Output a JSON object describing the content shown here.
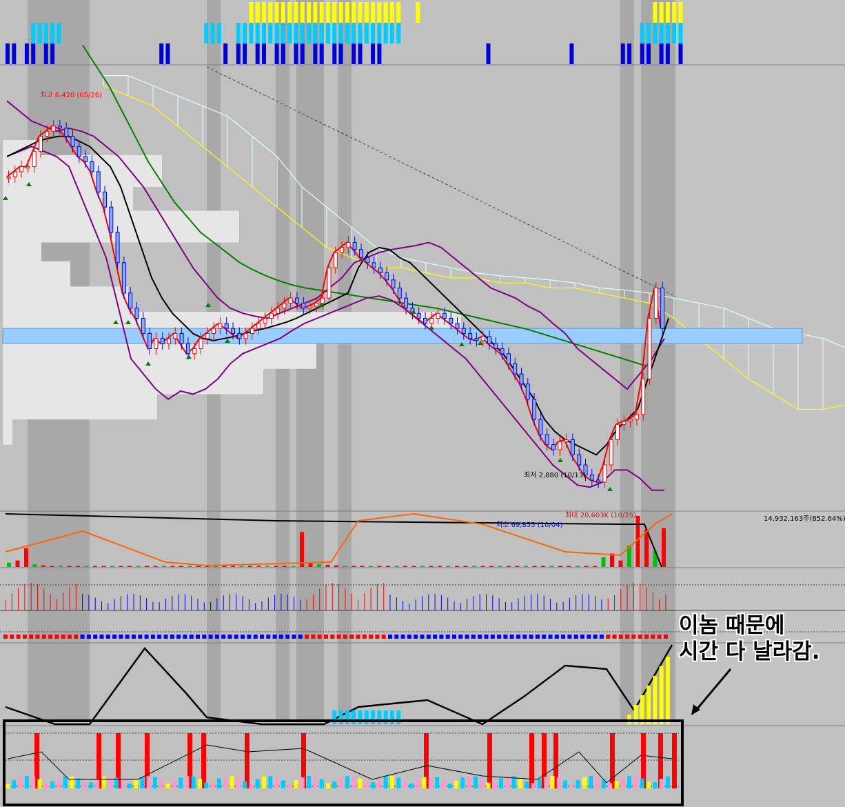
{
  "chart_data": {
    "type": "candlestick",
    "annotations": {
      "high": "최고 6,420 (05/26)",
      "low": "최저 2,880 (10/13)",
      "volume_max": "최대 20,603K (10/25)",
      "volume_min": "최소 69,855 (10/04)",
      "volume_last": "14,932,163주(852.64%)"
    },
    "close_series": [
      5900,
      5950,
      6000,
      6000,
      6150,
      6300,
      6350,
      6400,
      6380,
      6300,
      6200,
      6100,
      6050,
      5950,
      5750,
      5600,
      5350,
      5050,
      4750,
      4600,
      4500,
      4350,
      4200,
      4300,
      4250,
      4300,
      4350,
      4250,
      4150,
      4200,
      4300,
      4350,
      4400,
      4450,
      4400,
      4350,
      4300,
      4350,
      4400,
      4450,
      4500,
      4550,
      4600,
      4650,
      4700,
      4650,
      4600,
      4620,
      4650,
      4700,
      5000,
      5150,
      5200,
      5250,
      5180,
      5100,
      5050,
      5000,
      4950,
      4880,
      4800,
      4700,
      4600,
      4550,
      4500,
      4450,
      4500,
      4550,
      4500,
      4450,
      4400,
      4350,
      4300,
      4280,
      4320,
      4250,
      4200,
      4150,
      4050,
      3950,
      3850,
      3700,
      3500,
      3350,
      3250,
      3200,
      3280,
      3300,
      3150,
      3050,
      2950,
      2900,
      2880,
      3050,
      3300,
      3450,
      3480,
      3500,
      3550,
      3900,
      4500,
      4800,
      4400
    ],
    "ma_short": [
      6100,
      6150,
      6200,
      6250,
      6280,
      6300,
      6300,
      6250,
      6200,
      6100,
      6000,
      5800,
      5500,
      5200,
      4900,
      4700,
      4550,
      4450,
      4350,
      4300,
      4280,
      4300,
      4320,
      4350,
      4380,
      4400,
      4430,
      4460,
      4500,
      4550,
      4600,
      4650,
      4700,
      4750,
      5000,
      5150,
      5200,
      5180,
      5100,
      5050,
      4950,
      4850,
      4750,
      4650,
      4550,
      4450,
      4350,
      4250,
      4150,
      4000,
      3850,
      3700,
      3500,
      3380,
      3300,
      3250,
      3200,
      3150,
      3250,
      3400,
      3500,
      3600,
      3900,
      4200,
      4500
    ],
    "ma_long": [
      7200,
      7000,
      6800,
      6550,
      6300,
      6050,
      5850,
      5650,
      5500,
      5350,
      5250,
      5150,
      5050,
      4980,
      4920,
      4870,
      4830,
      4800,
      4780,
      4760,
      4740,
      4720,
      4700,
      4680,
      4660,
      4640,
      4620,
      4600,
      4570,
      4540,
      4510,
      4480,
      4450,
      4420,
      4390,
      4350,
      4310,
      4270,
      4230,
      4190,
      4150,
      4110,
      4070,
      4030
    ],
    "ichimoku_cloud": [
      {
        "a": 6800,
        "b": 6900
      },
      {
        "a": 6700,
        "b": 6900
      },
      {
        "a": 6600,
        "b": 6800
      },
      {
        "a": 6400,
        "b": 6700
      },
      {
        "a": 6200,
        "b": 6600
      },
      {
        "a": 6000,
        "b": 6500
      },
      {
        "a": 5800,
        "b": 6300
      },
      {
        "a": 5600,
        "b": 6100
      },
      {
        "a": 5400,
        "b": 5800
      },
      {
        "a": 5200,
        "b": 5600
      },
      {
        "a": 5100,
        "b": 5400
      },
      {
        "a": 5000,
        "b": 5200
      },
      {
        "a": 5000,
        "b": 5100
      },
      {
        "a": 4950,
        "b": 5050
      },
      {
        "a": 4900,
        "b": 5000
      },
      {
        "a": 4900,
        "b": 4950
      },
      {
        "a": 4850,
        "b": 4920
      },
      {
        "a": 4850,
        "b": 4900
      },
      {
        "a": 4800,
        "b": 4880
      },
      {
        "a": 4800,
        "b": 4850
      },
      {
        "a": 4750,
        "b": 4800
      },
      {
        "a": 4700,
        "b": 4780
      },
      {
        "a": 4650,
        "b": 4750
      },
      {
        "a": 4500,
        "b": 4700
      },
      {
        "a": 4300,
        "b": 4650
      },
      {
        "a": 4100,
        "b": 4600
      },
      {
        "a": 3900,
        "b": 4500
      },
      {
        "a": 3750,
        "b": 4400
      },
      {
        "a": 3600,
        "b": 4350
      },
      {
        "a": 3600,
        "b": 4300
      },
      {
        "a": 3650,
        "b": 4200
      },
      {
        "a": 3700,
        "b": 4100
      },
      {
        "a": 3800,
        "b": 4000
      }
    ],
    "bollinger_upper": [
      6650,
      6550,
      6450,
      6400,
      6350,
      6380,
      6350,
      6300,
      6200,
      6100,
      5950,
      5800,
      5600,
      5400,
      5200,
      5000,
      4850,
      4700,
      4600,
      4550,
      4520,
      4500,
      4550,
      4600,
      4650,
      4700,
      4800,
      4900,
      5050,
      5100,
      5150,
      5180,
      5200,
      5220,
      5250,
      5200,
      5100,
      5000,
      4900,
      4800,
      4750,
      4700,
      4620,
      4560,
      4450,
      4350,
      4200,
      4100,
      4000,
      3900,
      3800,
      3950,
      4100,
      4300
    ],
    "bollinger_lower": [
      6100,
      6150,
      6200,
      6150,
      6100,
      6000,
      5700,
      5400,
      5100,
      4600,
      4100,
      3950,
      3800,
      3700,
      3780,
      3750,
      3800,
      3900,
      4050,
      4150,
      4200,
      4250,
      4300,
      4380,
      4450,
      4500,
      4550,
      4600,
      4650,
      4700,
      4720,
      4680,
      4600,
      4500,
      4400,
      4300,
      4200,
      4100,
      3950,
      3800,
      3650,
      3500,
      3350,
      3200,
      3050,
      2950,
      2850,
      2830,
      2880,
      3000,
      3000,
      2920,
      2800,
      2800
    ],
    "resistance_band": [
      4400,
      4250
    ],
    "volume_profile": [
      {
        "price": 6100,
        "weight": 0.08
      },
      {
        "price": 5950,
        "weight": 0.33
      },
      {
        "price": 5650,
        "weight": 0.27
      },
      {
        "price": 5400,
        "weight": 0.49
      },
      {
        "price": 5150,
        "weight": 0.08
      },
      {
        "price": 4900,
        "weight": 0.14
      },
      {
        "price": 4650,
        "weight": 0.26
      },
      {
        "price": 4400,
        "weight": 0.95
      },
      {
        "price": 4150,
        "weight": 0.65
      },
      {
        "price": 3900,
        "weight": 0.54
      },
      {
        "price": 3650,
        "weight": 0.32
      },
      {
        "price": 3400,
        "weight": 0.02
      }
    ],
    "volume": [
      0.08,
      0.12,
      0.35,
      0.05,
      0.03,
      0.02,
      0.02,
      0.02,
      0.02,
      0.02,
      0.02,
      0.02,
      0.02,
      0.02,
      0.02,
      0.02,
      0.02,
      0.02,
      0.02,
      0.02,
      0.02,
      0.02,
      0.02,
      0.02,
      0.02,
      0.02,
      0.02,
      0.02,
      0.02,
      0.02,
      0.02,
      0.02,
      0.02,
      0.02,
      0.65,
      0.08,
      0.05,
      0.04,
      0.03,
      0.02,
      0.02,
      0.02,
      0.02,
      0.02,
      0.02,
      0.02,
      0.02,
      0.02,
      0.02,
      0.02,
      0.02,
      0.02,
      0.02,
      0.02,
      0.02,
      0.02,
      0.02,
      0.02,
      0.02,
      0.02,
      0.02,
      0.02,
      0.02,
      0.02,
      0.02,
      0.02,
      0.02,
      0.02,
      0.02,
      0.18,
      0.25,
      0.12,
      0.4,
      0.95,
      0.7,
      0.3,
      0.72
    ],
    "annotation_text": [
      "이놈 때문에",
      "시간 다 날라감."
    ],
    "colors": {
      "up": "#ff0000",
      "down": "#0000ff",
      "volume_up": "#ff0000",
      "volume_alt": "#00c000",
      "cloud_edge": "#ffff00",
      "band": "#99ccff",
      "ma_long": "#008000",
      "bollinger": "#800080"
    }
  }
}
